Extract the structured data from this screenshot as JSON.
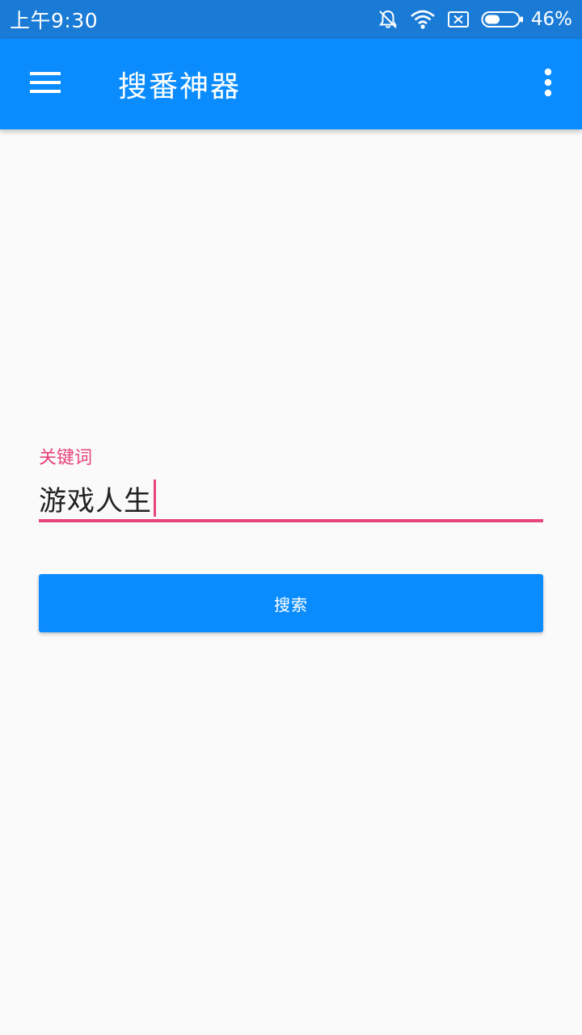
{
  "status_bar": {
    "time": "上午9:30",
    "battery_percent": "46%",
    "battery_level": 0.46,
    "icons": [
      "bell-muted-icon",
      "wifi-icon",
      "sim-blocked-icon",
      "battery-icon"
    ]
  },
  "app_bar": {
    "title": "搜番神器",
    "menu_icon": "hamburger-menu-icon",
    "overflow_icon": "more-vert-icon"
  },
  "search_form": {
    "keyword_label": "关键词",
    "keyword_value": "游戏人生",
    "submit_label": "搜索"
  },
  "colors": {
    "status_bar": "#1a7bd6",
    "app_bar": "#0a8cff",
    "accent": "#e8437a",
    "background": "#fafafa"
  }
}
